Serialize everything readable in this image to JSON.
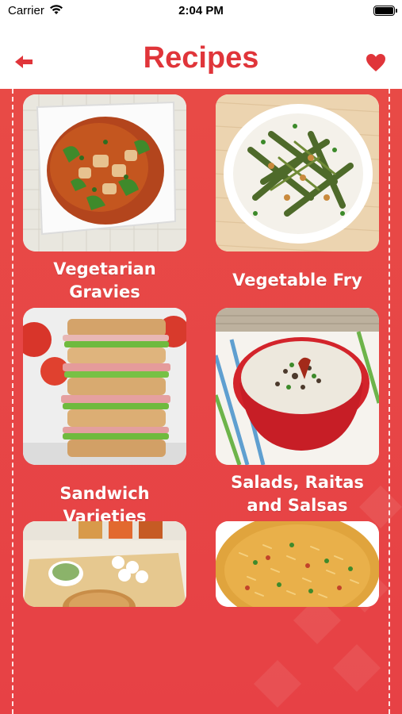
{
  "status_bar": {
    "carrier": "Carrier",
    "time": "2:04 PM"
  },
  "nav": {
    "title": "Recipes",
    "back_icon": "back-arrow-icon",
    "fav_icon": "heart-icon"
  },
  "colors": {
    "accent": "#e0353a",
    "background_red": "#e8413d"
  },
  "recipes": [
    {
      "label": "Vegetarian Gravies"
    },
    {
      "label": "Vegetable Fry"
    },
    {
      "label": "Sandwich Varieties"
    },
    {
      "label": "Salads, Raitas and Salsas"
    },
    {
      "label": ""
    },
    {
      "label": ""
    }
  ]
}
